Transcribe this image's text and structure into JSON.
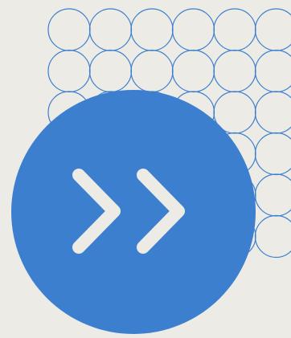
{
  "graphic": {
    "background_color": "#ecebe6",
    "accent_color": "#3c7fce",
    "icon_color": "#ecebe6",
    "pattern": "circle-grid",
    "icon": "double-chevron-right-icon"
  }
}
